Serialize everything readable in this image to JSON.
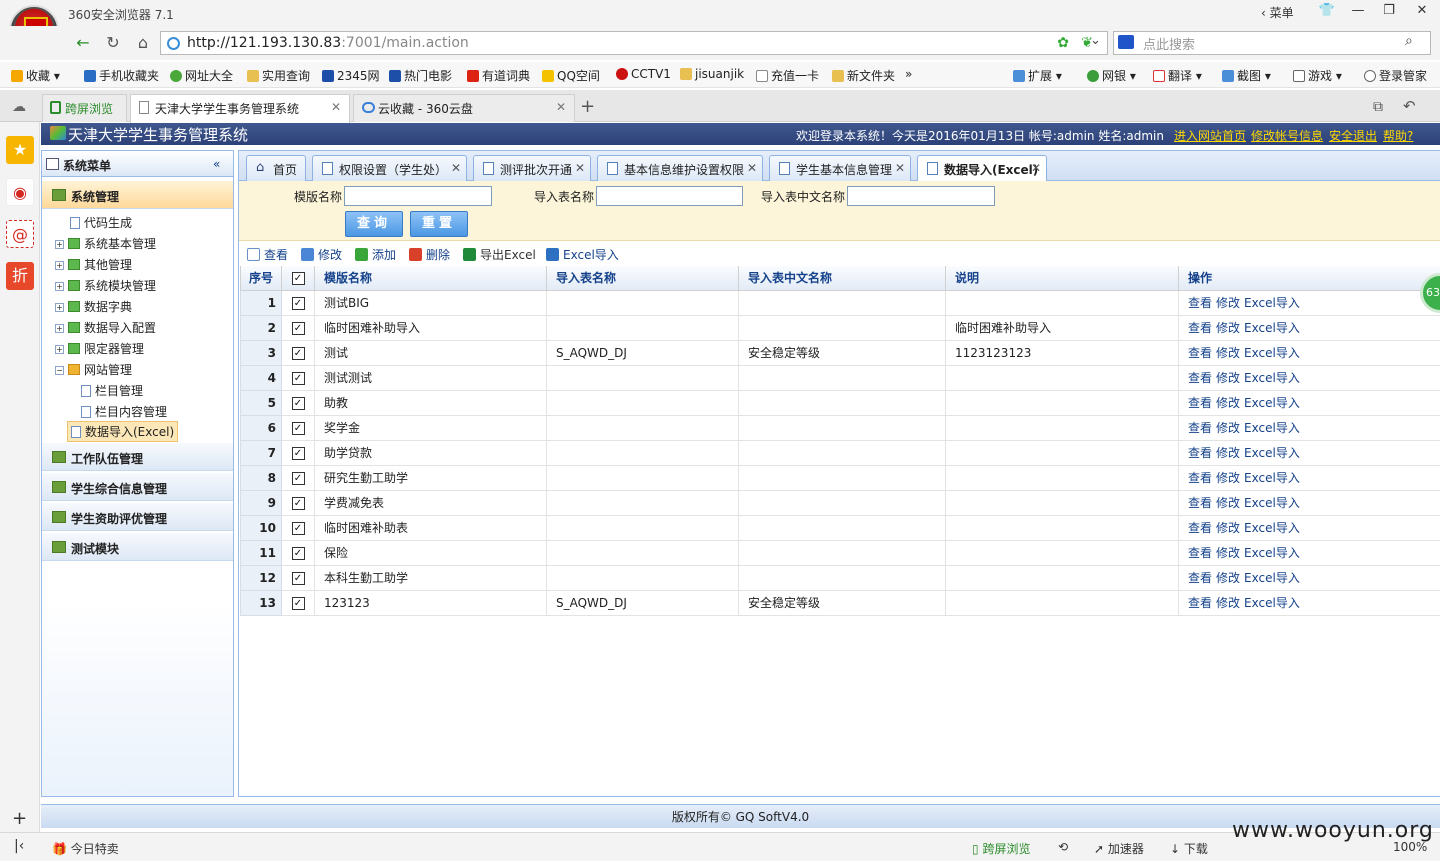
{
  "browser": {
    "window_title": "360安全浏览器 7.1",
    "menu_label": "菜单",
    "url_host": "http://121.193.130.83",
    "url_rest": ":7001/main.action",
    "search_placeholder": "点此搜索",
    "favorites": [
      "收藏",
      "手机收藏夹",
      "网址大全",
      "实用查询",
      "2345网",
      "热门电影",
      "有道词典",
      "QQ空间",
      "CCTV1",
      "jisuanjik",
      "充值一卡",
      "新文件夹"
    ],
    "favorites_more": "»",
    "extensions": [
      "扩展",
      "网银",
      "翻译",
      "截图",
      "游戏",
      "登录管家"
    ],
    "tabs": [
      {
        "label": "跨屏浏览"
      },
      {
        "label": "天津大学学生事务管理系统"
      },
      {
        "label": "云收藏 - 360云盘"
      }
    ],
    "new_tab": "+",
    "status": {
      "today_deals": "今日特卖",
      "cross_screen": "跨屏浏览",
      "accelerator": "加速器",
      "download": "下载",
      "zoom": "100%"
    }
  },
  "app": {
    "title": "天津大学学生事务管理系统",
    "welcome": "欢迎登录本系统！今天是2016年01月13日  帐号:admin 姓名:admin",
    "links": [
      "进入网站首页",
      "修改帐号信息",
      "安全退出",
      "帮助?"
    ],
    "footer": "版权所有© GQ SoftV4.0"
  },
  "sidebar": {
    "title": "系统菜单",
    "collapse": "«",
    "sections": [
      "系统管理",
      "工作队伍管理",
      "学生综合信息管理",
      "学生资助评优管理",
      "测试模块"
    ],
    "tree": [
      "代码生成",
      "系统基本管理",
      "其他管理",
      "系统模块管理",
      "数据字典",
      "数据导入配置",
      "限定器管理",
      "网站管理",
      "栏目管理",
      "栏目内容管理",
      "数据导入(Excel)"
    ]
  },
  "content_tabs": [
    "首页",
    "权限设置（学生处）",
    "测评批次开通",
    "基本信息维护设置权限",
    "学生基本信息管理",
    "数据导入(Excel)"
  ],
  "form": {
    "label_name": "模版名称",
    "label_table": "导入表名称",
    "label_table_cn": "导入表中文名称",
    "btn_query": "查询",
    "btn_reset": "重置"
  },
  "toolbar": [
    "查看",
    "修改",
    "添加",
    "删除",
    "导出Excel",
    "Excel导入"
  ],
  "grid": {
    "headers": [
      "序号",
      "模版名称",
      "导入表名称",
      "导入表中文名称",
      "说明",
      "操作"
    ],
    "op_view": "查看",
    "op_edit": "修改",
    "op_import": "Excel导入",
    "rows": [
      {
        "no": "1",
        "name": "测试BIG",
        "table": "",
        "table_cn": "",
        "desc": ""
      },
      {
        "no": "2",
        "name": "临时困难补助导入",
        "table": "",
        "table_cn": "",
        "desc": "临时困难补助导入"
      },
      {
        "no": "3",
        "name": "测试",
        "table": "S_AQWD_DJ",
        "table_cn": "安全稳定等级",
        "desc": "1123123123"
      },
      {
        "no": "4",
        "name": "测试测试",
        "table": "",
        "table_cn": "",
        "desc": ""
      },
      {
        "no": "5",
        "name": "助教",
        "table": "",
        "table_cn": "",
        "desc": ""
      },
      {
        "no": "6",
        "name": "奖学金",
        "table": "",
        "table_cn": "",
        "desc": ""
      },
      {
        "no": "7",
        "name": "助学贷款",
        "table": "",
        "table_cn": "",
        "desc": ""
      },
      {
        "no": "8",
        "name": "研究生勤工助学",
        "table": "",
        "table_cn": "",
        "desc": ""
      },
      {
        "no": "9",
        "name": "学费减免表",
        "table": "",
        "table_cn": "",
        "desc": ""
      },
      {
        "no": "10",
        "name": "临时困难补助表",
        "table": "",
        "table_cn": "",
        "desc": ""
      },
      {
        "no": "11",
        "name": "保险",
        "table": "",
        "table_cn": "",
        "desc": ""
      },
      {
        "no": "12",
        "name": "本科生勤工助学",
        "table": "",
        "table_cn": "",
        "desc": ""
      },
      {
        "no": "13",
        "name": "123123",
        "table": "S_AQWD_DJ",
        "table_cn": "安全稳定等级",
        "desc": ""
      }
    ]
  },
  "overlays": {
    "badge": "63",
    "watermark": "www.wooyun.org"
  },
  "colors": {
    "header": "#2c4177",
    "link_yellow": "#ffd800",
    "grid_text": "#15428b",
    "form_bg": "#fcf5d9"
  }
}
